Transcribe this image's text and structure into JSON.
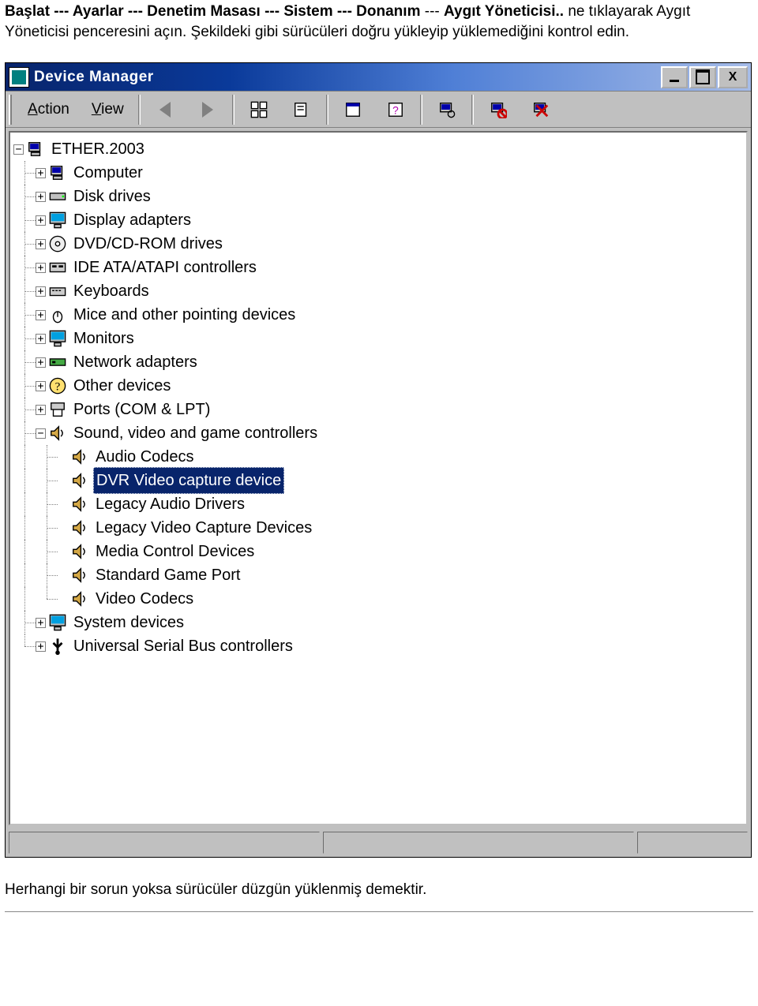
{
  "instruction": {
    "parts": [
      {
        "text": "Başlat --- Ayarlar --- Denetim Masası --- Sistem --- Donanım",
        "bold": true
      },
      {
        "text": "  ---  ",
        "bold": false
      },
      {
        "text": "Aygıt Yöneticisi..",
        "bold": true
      },
      {
        "text": " ne tıklayarak Aygıt Yöneticisi penceresini açın. Şekildeki gibi sürücüleri doğru yükleyip yüklemediğini kontrol edin.",
        "bold": false
      }
    ]
  },
  "window": {
    "title": "Device Manager",
    "menu": {
      "action": "Action",
      "view": "View"
    },
    "window_buttons": {
      "close_label": "X"
    }
  },
  "tree": {
    "root": "ETHER.2003",
    "nodes": [
      {
        "label": "Computer",
        "icon": "ic-computer",
        "expanded": false
      },
      {
        "label": "Disk drives",
        "icon": "ic-disk",
        "expanded": false
      },
      {
        "label": "Display adapters",
        "icon": "ic-monitor",
        "expanded": false
      },
      {
        "label": "DVD/CD-ROM drives",
        "icon": "ic-cd",
        "expanded": false
      },
      {
        "label": "IDE ATA/ATAPI controllers",
        "icon": "ic-controller",
        "expanded": false
      },
      {
        "label": "Keyboards",
        "icon": "ic-keyboard",
        "expanded": false
      },
      {
        "label": "Mice and other pointing devices",
        "icon": "ic-mouse",
        "expanded": false
      },
      {
        "label": "Monitors",
        "icon": "ic-monitor",
        "expanded": false
      },
      {
        "label": "Network adapters",
        "icon": "ic-network",
        "expanded": false
      },
      {
        "label": "Other devices",
        "icon": "ic-question",
        "expanded": false
      },
      {
        "label": "Ports (COM & LPT)",
        "icon": "ic-port",
        "expanded": false
      },
      {
        "label": "Sound, video and game controllers",
        "icon": "ic-sound",
        "expanded": true,
        "children": [
          {
            "label": "Audio Codecs",
            "icon": "ic-sound"
          },
          {
            "label": "DVR Video capture device",
            "icon": "ic-sound",
            "selected": true
          },
          {
            "label": "Legacy Audio Drivers",
            "icon": "ic-sound"
          },
          {
            "label": "Legacy Video Capture Devices",
            "icon": "ic-sound"
          },
          {
            "label": "Media Control Devices",
            "icon": "ic-sound"
          },
          {
            "label": "Standard Game Port",
            "icon": "ic-sound"
          },
          {
            "label": "Video Codecs",
            "icon": "ic-sound"
          }
        ]
      },
      {
        "label": "System devices",
        "icon": "ic-monitor",
        "expanded": false
      },
      {
        "label": "Universal Serial Bus controllers",
        "icon": "ic-usb",
        "expanded": false
      }
    ]
  },
  "footer": "Herhangi bir sorun yoksa sürücüler düzgün yüklenmiş demektir."
}
